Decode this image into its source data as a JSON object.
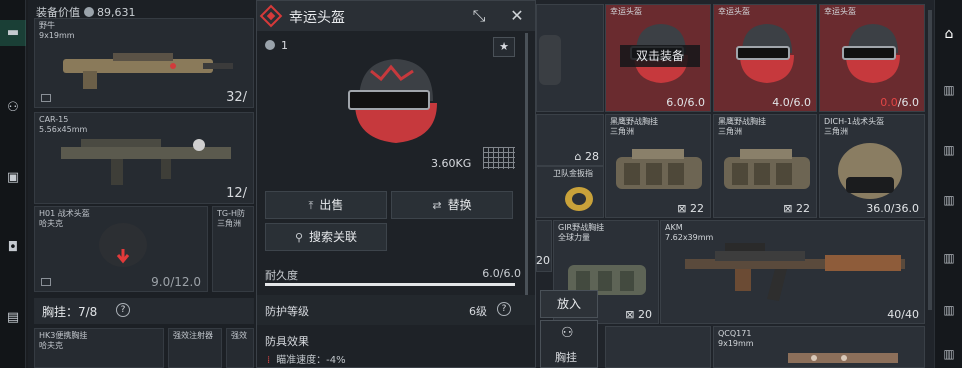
{
  "equipment": {
    "value_label": "装备价值",
    "value": "89,631",
    "slots": [
      {
        "name": "野牛",
        "caliber": "9x19mm",
        "count": "32/"
      },
      {
        "name": "CAR-15",
        "caliber": "5.56x45mm",
        "count": "12/"
      },
      {
        "name": "H01 战术头盔",
        "sub": "哈夫克",
        "durability": "9.0/12.0"
      },
      {
        "name": "TG-H防",
        "sub": "三角洲"
      }
    ],
    "chest_label": "胸挂：7/8",
    "chest_help": "?",
    "bottom_items": [
      {
        "name": "HK3便携胸挂",
        "sub": "哈夫克"
      },
      {
        "name": "强效注射器"
      },
      {
        "name": "强效"
      }
    ]
  },
  "popup": {
    "title": "幸运头盔",
    "quantity": "1",
    "weight": "3.60KG",
    "sell_label": "出售",
    "replace_label": "替换",
    "search_label": "搜索关联",
    "durability_label": "耐久度",
    "durability_value": "6.0/6.0",
    "durability_fraction": 1.0,
    "protection_label": "防护等级",
    "protection_value": "6级",
    "protection_help": "?",
    "effect_label": "防具效果",
    "effect_item": "瞄准速度：-4%"
  },
  "inventory": {
    "helmets": [
      {
        "name": "幸运头盔",
        "value": "6.0/6.0",
        "overlay": "双击装备"
      },
      {
        "name": "幸运头盔",
        "value": "4.0/6.0"
      },
      {
        "name": "幸运头盔",
        "value_low": "0.0",
        "value_rest": "/6.0"
      }
    ],
    "row2": [
      {
        "count": "28"
      },
      {
        "name": "黑鹰野战胸挂",
        "sub": "三角洲",
        "count": "22"
      },
      {
        "name": "黑鹰野战胸挂",
        "sub": "三角洲",
        "count": "22"
      },
      {
        "name": "DICH-1战术头盔",
        "sub": "三角洲",
        "value": "36.0/36.0"
      }
    ],
    "gold_item": {
      "name": "卫队金扳指"
    },
    "row3_left_count": "20",
    "gir": {
      "name": "GIR野战胸挂",
      "sub": "全球力量",
      "count": "20"
    },
    "akm": {
      "name": "AKM",
      "caliber": "7.62x39mm",
      "count": "40/40"
    },
    "place_label": "放入",
    "chest_slot_label": "胸挂",
    "qcq": {
      "name": "QCQ171",
      "caliber": "9x19mm"
    }
  },
  "colors": {
    "accent_red": "#d63a3a",
    "low_durability": "#e14545",
    "panel": "#1e2227"
  }
}
